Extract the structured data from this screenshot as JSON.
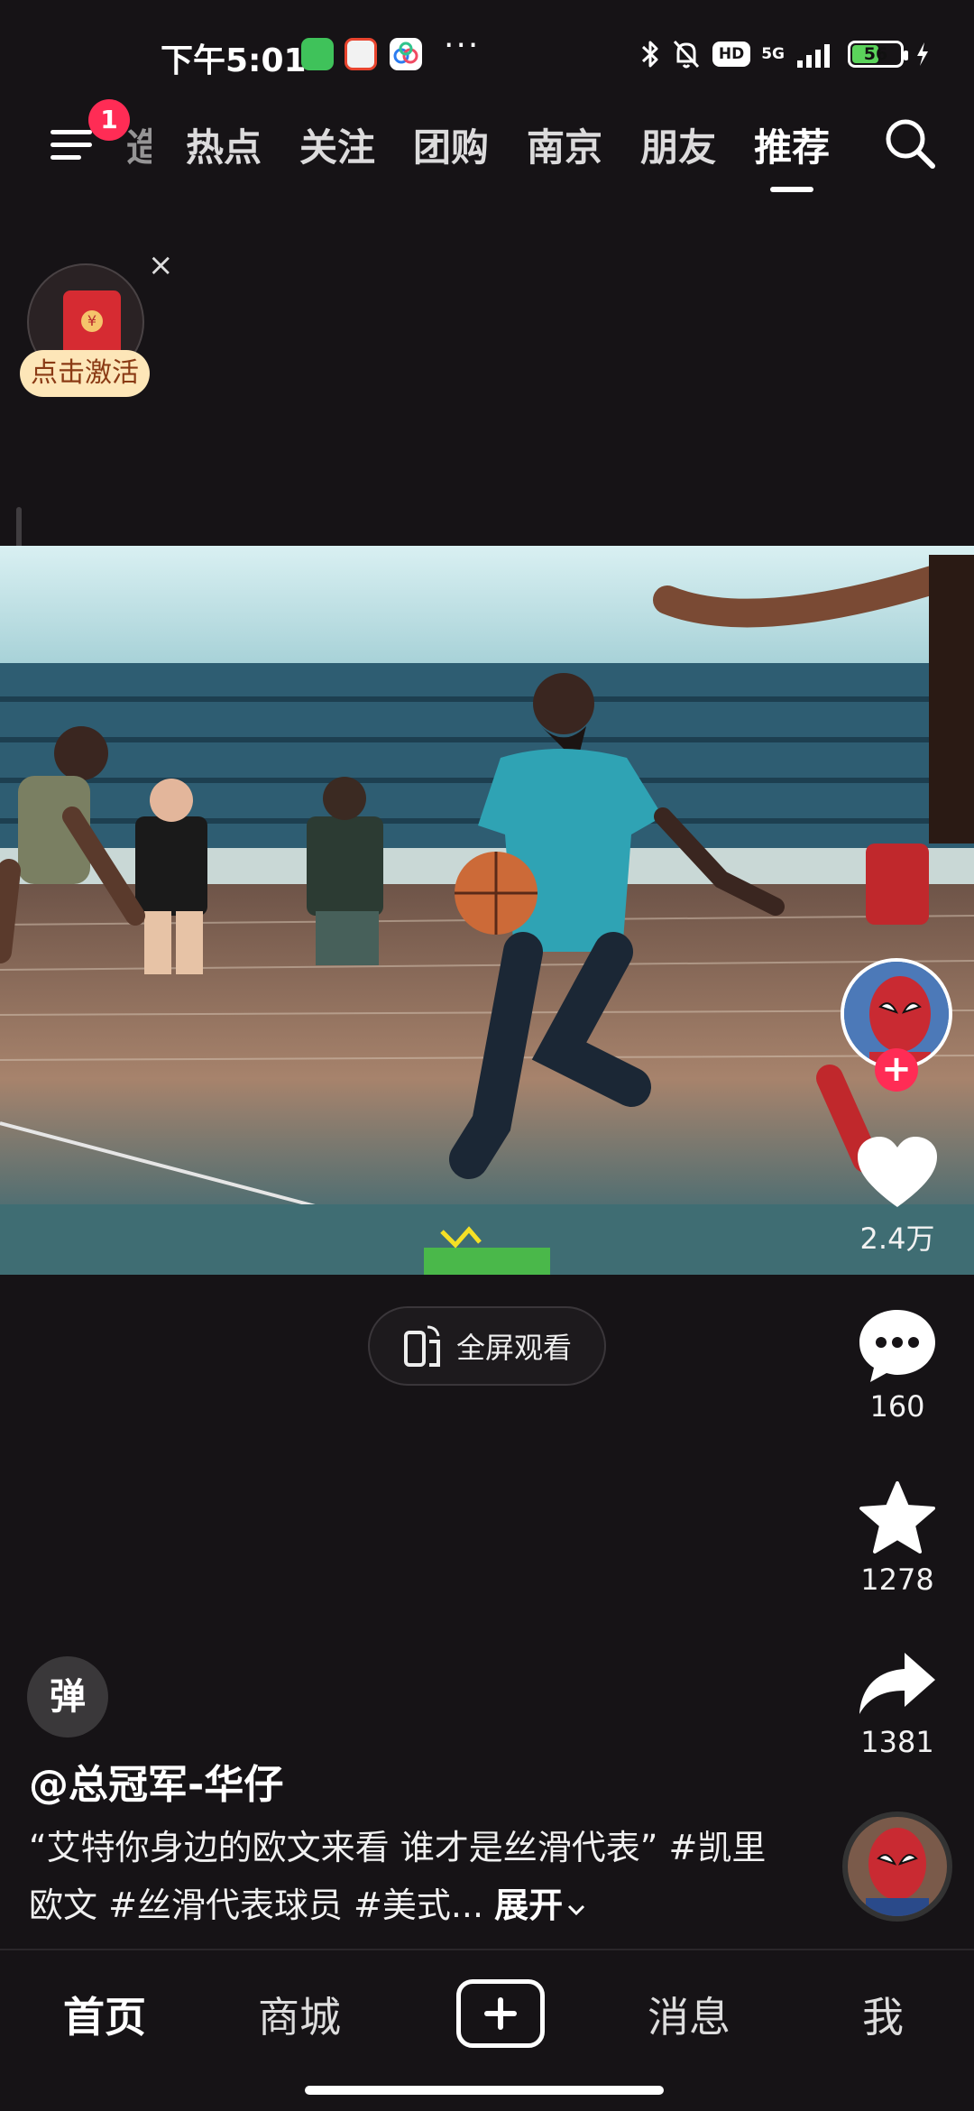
{
  "status_bar": {
    "time": "下午5:01",
    "network": "5G",
    "hd": "HD",
    "battery_level": "56",
    "battery_fraction": 0.56,
    "app_icons": [
      "chat-app-icon",
      "58-app-icon",
      "cloud-app-icon"
    ],
    "more": "···"
  },
  "top_nav": {
    "menu_badge": "1",
    "partial_tab": "造",
    "tabs": [
      {
        "label": "热点"
      },
      {
        "label": "关注"
      },
      {
        "label": "团购"
      },
      {
        "label": "南京"
      },
      {
        "label": "朋友"
      },
      {
        "label": "推荐",
        "active": true
      }
    ]
  },
  "red_packet": {
    "label": "点击激活",
    "close": "×",
    "seal": "¥"
  },
  "video": {
    "fullscreen_label": "全屏观看"
  },
  "rail": {
    "likes": "2.4万",
    "comments": "160",
    "favorites": "1278",
    "shares": "1381",
    "follow": "+"
  },
  "post": {
    "danmaku": "弹",
    "author": "@总冠军-华仔",
    "description": "“艾特你身边的欧文来看 谁才是丝滑代表” #凯里欧文 #丝滑代表球员 #美式...",
    "expand": "展开"
  },
  "bottom_nav": {
    "items": [
      "首页",
      "商城",
      "消息",
      "我"
    ]
  },
  "colors": {
    "background": "#161316",
    "accent": "#ff2c55",
    "red_packet": "#d62b32"
  }
}
